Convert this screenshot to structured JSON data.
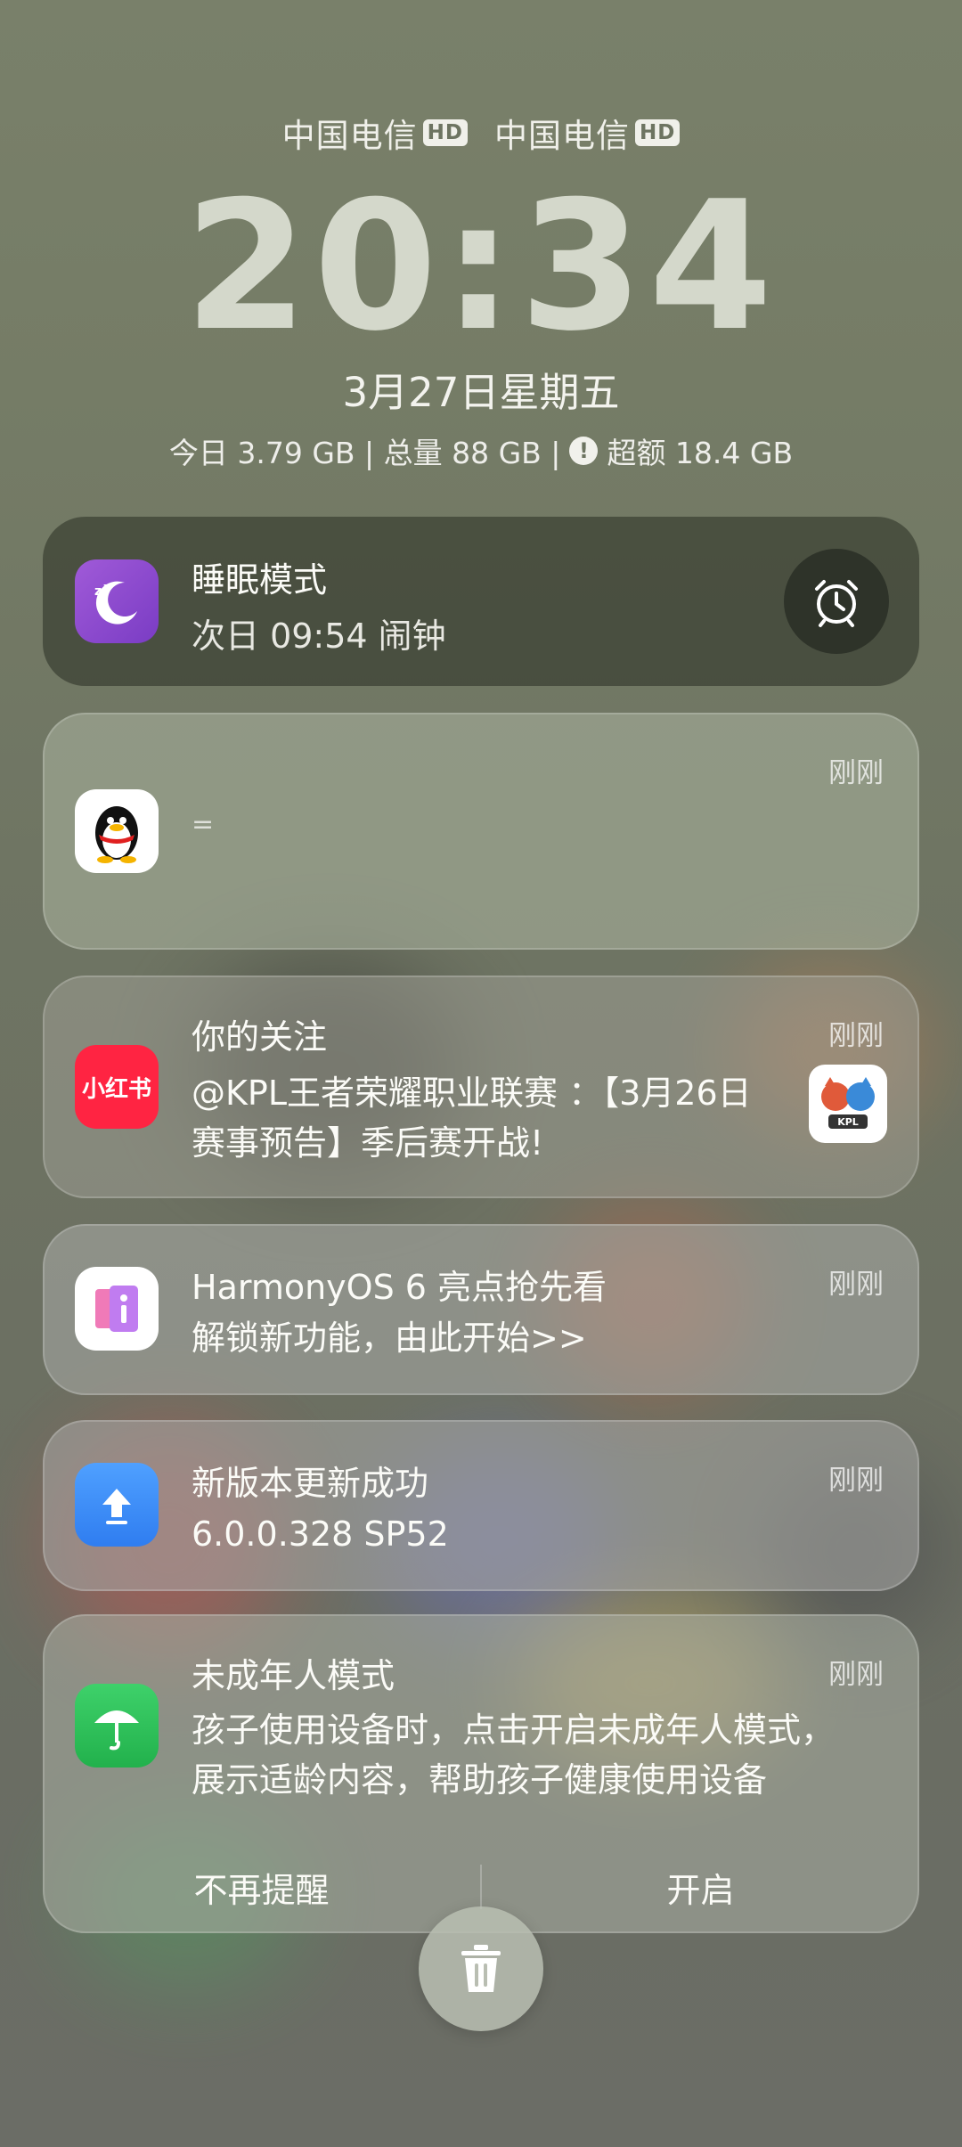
{
  "status": {
    "carrier1": "中国电信",
    "carrier2": "中国电信",
    "hd_badge": "HD"
  },
  "lockscreen": {
    "time": "20:34",
    "date": "3月27日星期五",
    "data_usage_part1": "今日 3.79 GB | 总量 88 GB |",
    "data_usage_part2": "超额 18.4 GB"
  },
  "notifications": {
    "sleep": {
      "title": "睡眠模式",
      "body": "次日 09:54 闹钟"
    },
    "qq": {
      "time": "刚刚",
      "body": "="
    },
    "xiaohongshu": {
      "icon_text": "小红书",
      "title": "你的关注",
      "body": "@KPL王者荣耀职业联赛 ：【3月26日赛事预告】季后赛开战!",
      "time": "刚刚",
      "thumb_text": "KPL"
    },
    "harmony": {
      "title": "HarmonyOS 6 亮点抢先看",
      "body": "解锁新功能，由此开始>>",
      "time": "刚刚"
    },
    "update": {
      "title": "新版本更新成功",
      "body": "6.0.0.328 SP52",
      "time": "刚刚"
    },
    "minor": {
      "title": "未成年人模式",
      "body": "孩子使用设备时，点击开启未成年人模式，展示适龄内容，帮助孩子健康使用设备",
      "time": "刚刚",
      "action_dismiss": "不再提醒",
      "action_enable": "开启"
    }
  }
}
